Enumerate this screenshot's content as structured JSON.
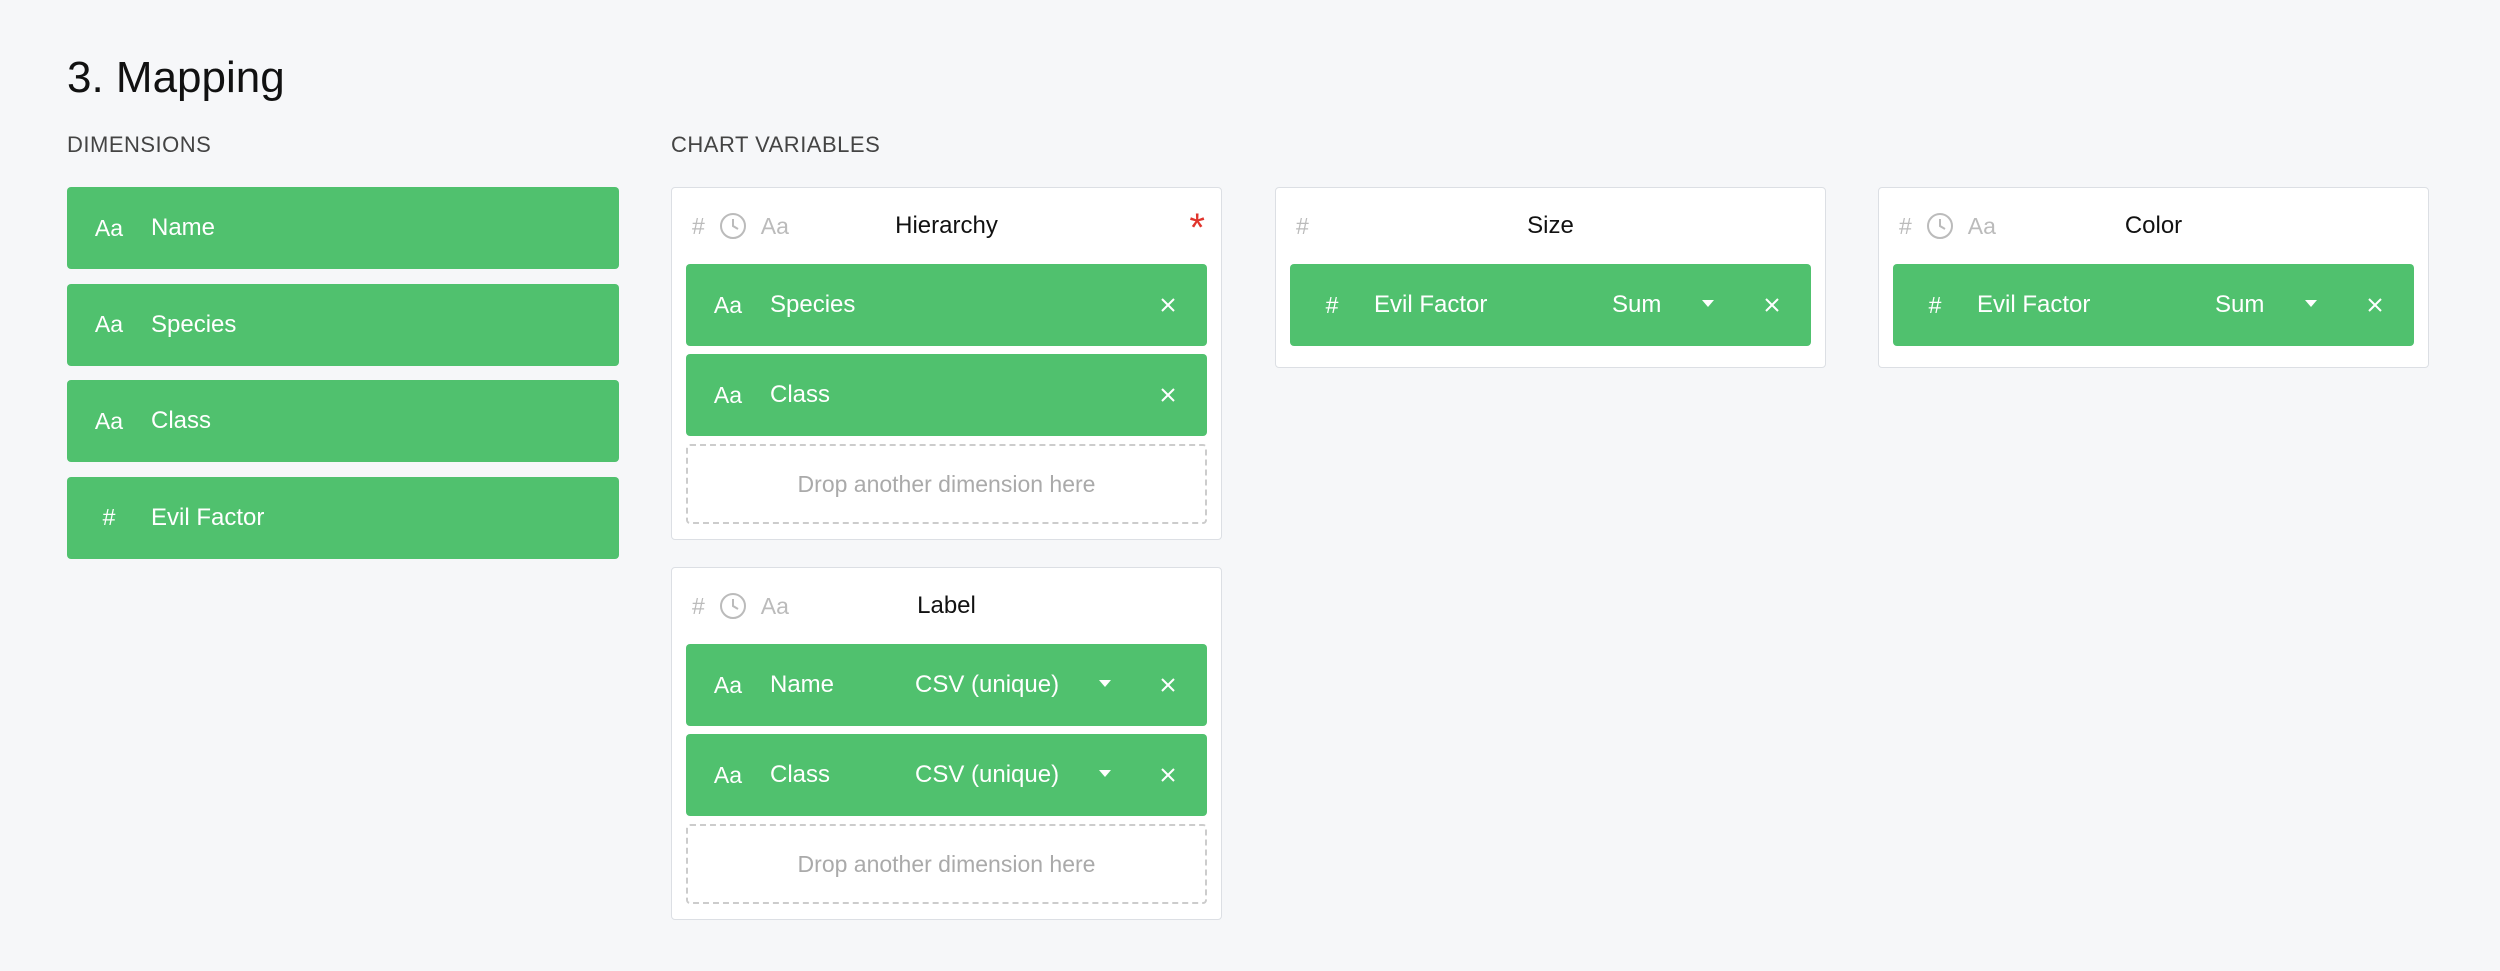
{
  "title": "3. Mapping",
  "dimensions": {
    "label": "DIMENSIONS",
    "items": [
      {
        "type": "Aa",
        "name": "Name"
      },
      {
        "type": "Aa",
        "name": "Species"
      },
      {
        "type": "Aa",
        "name": "Class"
      },
      {
        "type": "#",
        "name": "Evil Factor"
      }
    ]
  },
  "chart_variables": {
    "label": "CHART VARIABLES",
    "type_icons": {
      "number": "#",
      "date": "clock-icon",
      "string": "Aa"
    },
    "hierarchy": {
      "title": "Hierarchy",
      "required": "*",
      "items": [
        {
          "type": "Aa",
          "name": "Species"
        },
        {
          "type": "Aa",
          "name": "Class"
        }
      ],
      "dropzone": "Drop another dimension here"
    },
    "size": {
      "title": "Size",
      "items": [
        {
          "type": "#",
          "name": "Evil Factor",
          "aggregation": "Sum"
        }
      ]
    },
    "color": {
      "title": "Color",
      "items": [
        {
          "type": "#",
          "name": "Evil Factor",
          "aggregation": "Sum"
        }
      ]
    },
    "label_var": {
      "title": "Label",
      "items": [
        {
          "type": "Aa",
          "name": "Name",
          "aggregation": "CSV (unique)"
        },
        {
          "type": "Aa",
          "name": "Class",
          "aggregation": "CSV (unique)"
        }
      ],
      "dropzone": "Drop another dimension here"
    }
  },
  "colors": {
    "pill": "#50c16e",
    "required": "#e0342c",
    "background": "#f6f7f9"
  }
}
